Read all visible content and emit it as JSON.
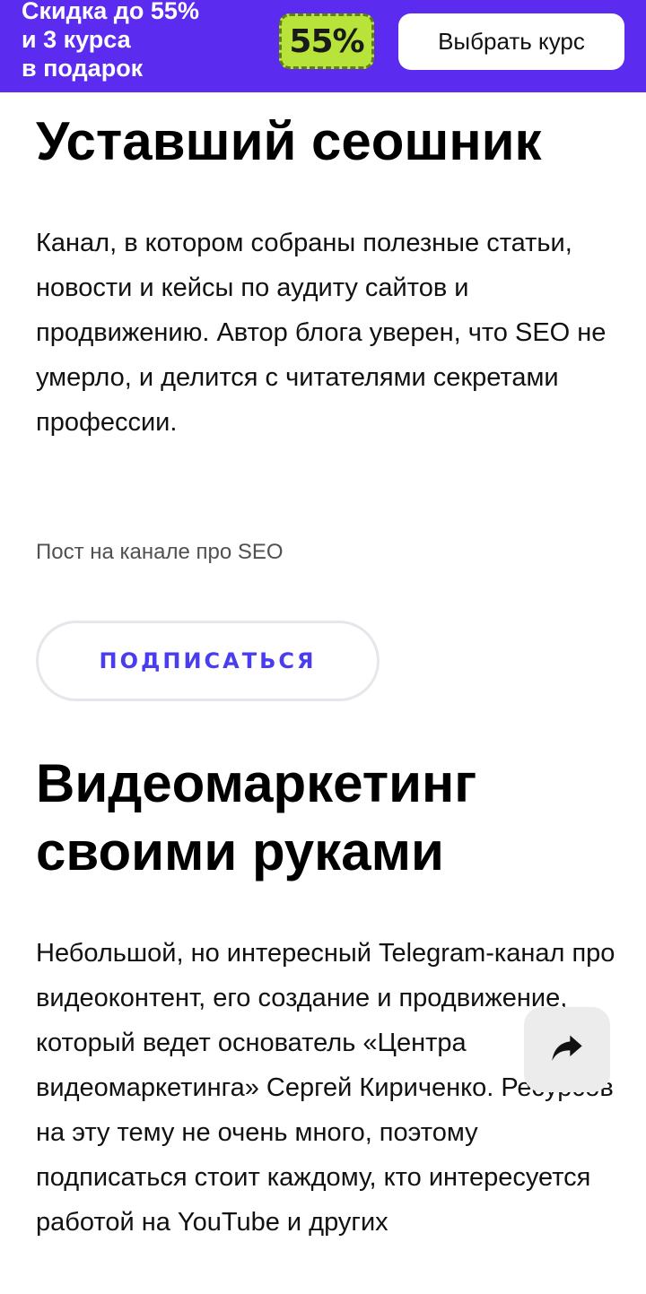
{
  "promo_banner": {
    "text": "Скидка до 55%\nи 3 курса\nв подарок",
    "badge": "55%",
    "button_label": "Выбрать курс",
    "colors": {
      "background": "#5b2cf0",
      "badge": "#b7e33a",
      "button": "#ffffff"
    }
  },
  "sections": [
    {
      "title": "Уставший сеошник",
      "description": "Канал, в котором собраны полезные статьи, новости и кейсы по аудиту сайтов и продвижению. Автор блога уверен, что SEO не умерло, и делится с читателями секретами профессии.",
      "caption": "Пост на канале про SEO",
      "subscribe_label": "ПОДПИСАТЬСЯ"
    },
    {
      "title": "Видеомаркетинг своими руками",
      "description": "Небольшой, но интересный Telegram-канал про видеоконтент, его создание и продвижение, который ведет основатель «Центра видеомаркетинга» Сергей Кириченко. Ресурсов на эту тему не очень много, поэтому подписаться стоит каждому, кто интересуется работой на YouTube и других"
    }
  ],
  "share_button": {
    "icon": "share-arrow-icon"
  },
  "accent_color": "#4a3df0"
}
